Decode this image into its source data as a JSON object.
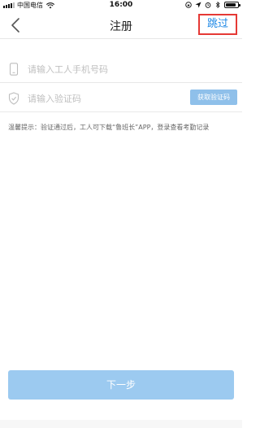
{
  "status_bar": {
    "carrier": "中国电信",
    "time": "16:00"
  },
  "nav": {
    "title": "注册",
    "skip_label": "跳过"
  },
  "form": {
    "phone_placeholder": "请输入工人手机号码",
    "code_placeholder": "请输入验证码",
    "get_code_label": "获取验证码"
  },
  "tip": "温馨提示：验证通过后，工人可下载“鲁班长”APP，登录查看考勤记录",
  "next_label": "下一步",
  "colors": {
    "accent": "#1e88e5",
    "skip_border": "#e53935",
    "button_disabled": "#9ccaf0"
  },
  "icons": {
    "phone": "phone-icon",
    "shield": "shield-icon",
    "back": "chevron-left-icon"
  }
}
